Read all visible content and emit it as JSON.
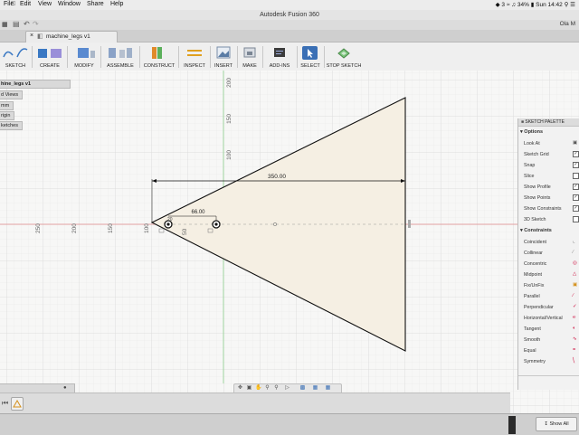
{
  "menubar": {
    "items": [
      "File",
      "Edit",
      "View",
      "Window",
      "Share",
      "Help"
    ],
    "status": {
      "badge": "3",
      "battery": "34%",
      "clock": "Sun 14:42"
    }
  },
  "window": {
    "title": "Autodesk Fusion 360",
    "user": "Ola M"
  },
  "document": {
    "tab": "machine_legs v1"
  },
  "toolbar": {
    "sketch": "SKETCH",
    "create": "CREATE",
    "modify": "MODIFY",
    "assemble": "ASSEMBLE",
    "construct": "CONSTRUCT",
    "inspect": "INSPECT",
    "insert": "INSERT",
    "make": "MAKE",
    "addins": "ADD-INS",
    "select": "SELECT",
    "stop": "STOP SKETCH"
  },
  "browser": {
    "root": "hine_legs v1",
    "items": [
      "d Views",
      "mm",
      "rigin",
      "ketches"
    ]
  },
  "canvas": {
    "ruler_h": [
      "250",
      "200",
      "150",
      "100",
      "50"
    ],
    "ruler_v": [
      "200",
      "150",
      "100"
    ],
    "dim_width": "350.00",
    "dim_small": "66.00",
    "dim_small2": "20"
  },
  "palette": {
    "title": "SKETCH PALETTE",
    "options_title": "Options",
    "options": [
      "Look At",
      "Sketch Grid",
      "Snap",
      "Slice",
      "Show Profile",
      "Show Points",
      "Show Constraints",
      "3D Sketch"
    ],
    "options_checked": [
      false,
      true,
      true,
      false,
      true,
      true,
      true,
      false
    ],
    "constraints_title": "Constraints",
    "constraints": [
      "Coincident",
      "Collinear",
      "Concentric",
      "Midpoint",
      "Fix/UnFix",
      "Parallel",
      "Perpendicular",
      "Horizontal/Vertical",
      "Tangent",
      "Smooth",
      "Equal",
      "Symmetry"
    ]
  },
  "bottom": {
    "show_all": "Show All"
  },
  "colors": {
    "accent": "#3a78c3",
    "sketch_fill": "#f5efe3",
    "axis_red": "#e06a6a",
    "axis_green": "#6cc36c"
  }
}
